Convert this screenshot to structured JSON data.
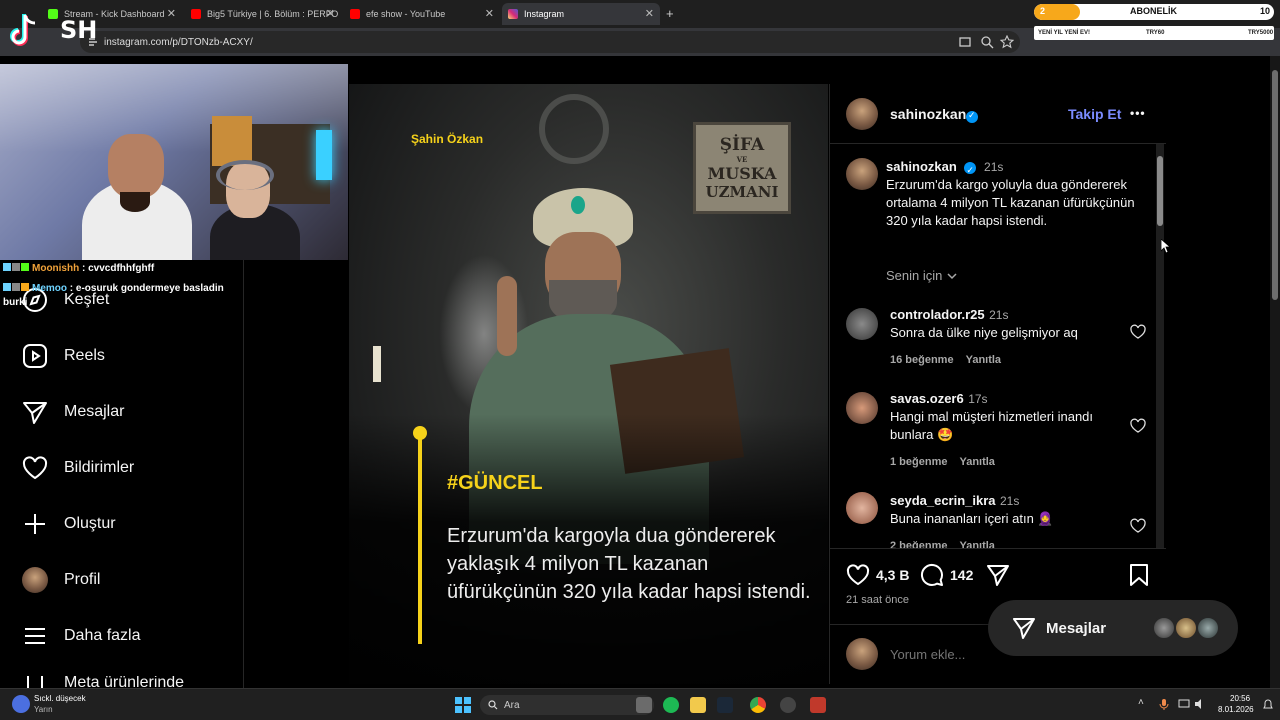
{
  "browser": {
    "tabs": [
      {
        "label": "Stream - Kick Dashboard",
        "color": "#53fc18"
      },
      {
        "label": "Big5 Türkiye | 6. Bölüm : PERFO",
        "color": "#ff0000"
      },
      {
        "label": "efe show - YouTube",
        "color": "#ff0000"
      },
      {
        "label": "Instagram",
        "color": "#e1306c"
      }
    ],
    "new_tab": "+",
    "close_glyph": "✕",
    "url": "instagram.com/p/DTONzb-ACXY/"
  },
  "overlay": {
    "logo": "SH",
    "subscription": {
      "label": "ABONELİK",
      "count_left": "2",
      "count_right": "10",
      "goal_label": "YENİ YIL YENİ EV!",
      "min": "TRY60",
      "max": "TRY5000"
    },
    "chat": [
      {
        "user": "Moonishh",
        "message": "cvvcdfhhfghff",
        "user_color": "#f0a23a"
      },
      {
        "user": "Memoo",
        "message": "e-osuruk gondermeye basladin burki",
        "user_color": "#6ed3ff"
      }
    ]
  },
  "sidebar": {
    "items": [
      {
        "label": "Keşfet",
        "icon": "compass-icon"
      },
      {
        "label": "Reels",
        "icon": "reels-icon"
      },
      {
        "label": "Mesajlar",
        "icon": "send-icon"
      },
      {
        "label": "Bildirimler",
        "icon": "heart-icon"
      },
      {
        "label": "Oluştur",
        "icon": "plus-icon"
      },
      {
        "label": "Profil",
        "icon": "avatar"
      },
      {
        "label": "Daha fazla",
        "icon": "menu-icon"
      },
      {
        "label": "Meta ürünlerinde",
        "icon": "meta-icon"
      }
    ]
  },
  "post_image": {
    "author_tag": "Şahin Özkan",
    "sign_lines": [
      "ŞİFA",
      "VE",
      "MUSKA",
      "UZMANI"
    ],
    "hashtag": "#GÜNCEL",
    "headline": "Erzurum'da kargoyla dua göndererek yaklaşık 4 milyon TL kazanan üfürükçünün 320 yıla kadar hapsi istendi."
  },
  "post": {
    "username": "sahinozkan",
    "follow_label": "Takip Et",
    "more": "•••",
    "caption_time": "21s",
    "caption": "Erzurum'da kargo yoluyla dua göndererek ortalama 4 milyon TL kazanan üfürükçünün 320 yıla kadar hapsi istendi.",
    "for_you_label": "Senin için",
    "comments": [
      {
        "user": "controlador.r25",
        "time": "21s",
        "text": "Sonra da ülke niye gelişmiyor aq",
        "likes": "16 beğenme",
        "reply": "Yanıtla"
      },
      {
        "user": "savas.ozer6",
        "time": "17s",
        "text": "Hangi mal müşteri hizmetleri inandı bunlara 🤩",
        "likes": "1 beğenme",
        "reply": "Yanıtla"
      },
      {
        "user": "seyda_ecrin_ikra",
        "time": "21s",
        "text": "Buna inananları içeri atın 🧕",
        "likes": "2 beğenme",
        "reply": "Yanıtla"
      }
    ],
    "like_count": "4,3 B",
    "comment_count": "142",
    "posted_ago": "21 saat önce",
    "add_comment_placeholder": "Yorum ekle..."
  },
  "messages_pill": {
    "label": "Mesajlar"
  },
  "taskbar": {
    "weather_title": "Sıckl. düşecek",
    "weather_sub": "Yarın",
    "search_placeholder": "Ara",
    "time": "20:56",
    "date": "8.01.2026"
  }
}
